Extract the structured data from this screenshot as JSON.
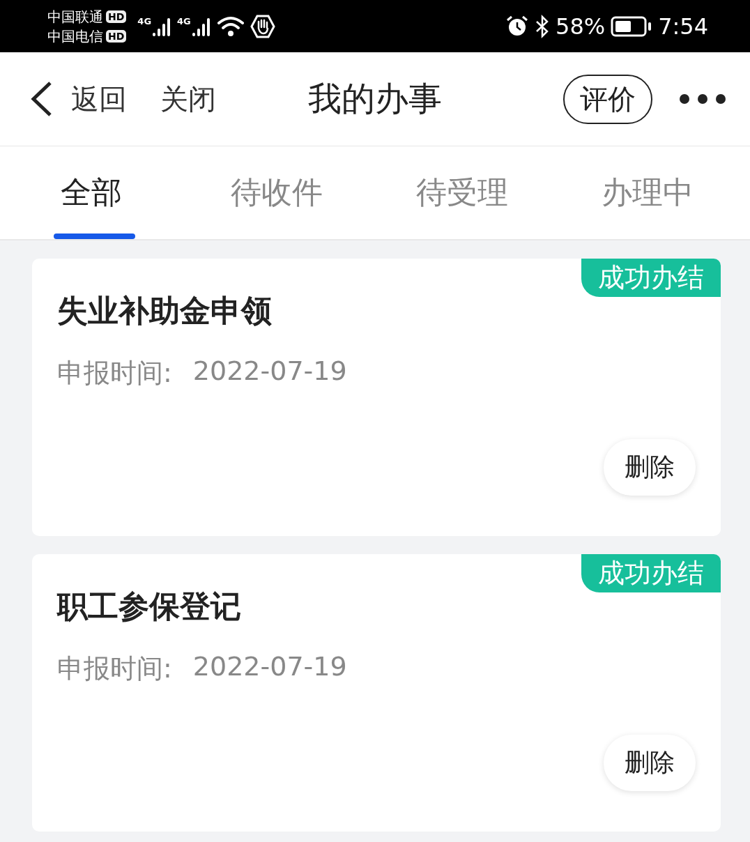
{
  "status_bar": {
    "carriers": [
      {
        "name": "中国联通",
        "badge": "HD"
      },
      {
        "name": "中国电信",
        "badge": "HD"
      }
    ],
    "signals": [
      {
        "network": "4G"
      },
      {
        "network": "4G"
      }
    ],
    "battery": "58%",
    "time": "7:54"
  },
  "nav": {
    "back": "返回",
    "close": "关闭",
    "title": "我的办事",
    "rate": "评价"
  },
  "tabs": [
    {
      "label": "全部",
      "selected": true
    },
    {
      "label": "待收件",
      "selected": false
    },
    {
      "label": "待受理",
      "selected": false
    },
    {
      "label": "办理中",
      "selected": false
    }
  ],
  "cards": [
    {
      "title": "失业补助金申领",
      "status": "成功办结",
      "date_label": "申报时间:",
      "date": "2022-07-19",
      "action": "删除"
    },
    {
      "title": "职工参保登记",
      "status": "成功办结",
      "date_label": "申报时间:",
      "date": "2022-07-19",
      "action": "删除"
    }
  ]
}
